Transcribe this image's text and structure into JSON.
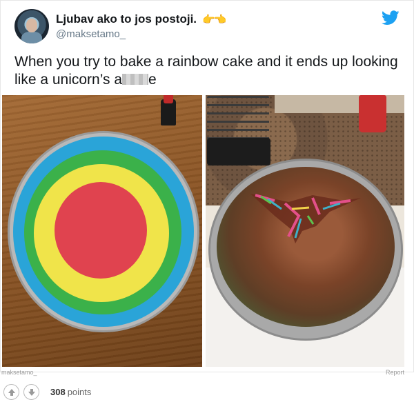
{
  "tweet": {
    "display_name": "Ljubav ako to jos postoji.",
    "name_emoji": "👉👈",
    "handle": "@maksetamo_",
    "text_before_censor": "When you try to bake a rainbow cake and it ends up looking like a unicorn’s a",
    "text_after_censor": "e"
  },
  "icons": {
    "brand": "twitter-bird-icon",
    "upvote": "arrow-up-icon",
    "downvote": "arrow-down-icon"
  },
  "colors": {
    "twitter_blue": "#1da1f2",
    "rainbow": [
      "#2aa4d8",
      "#3bb14a",
      "#f0e44a",
      "#e0434f"
    ]
  },
  "footer": {
    "photo_credit": "maksetamo_",
    "report_label": "Report",
    "points_value": "308",
    "points_label": "points"
  }
}
